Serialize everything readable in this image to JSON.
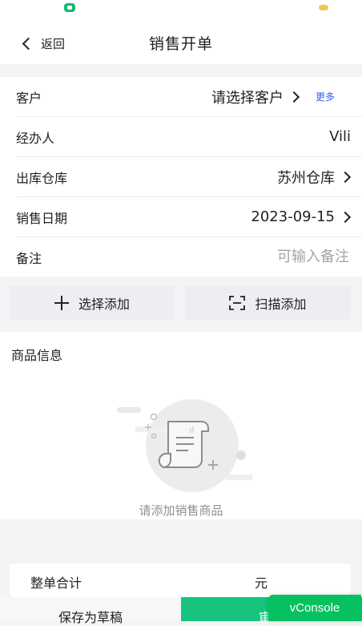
{
  "nav": {
    "back_label": "返回",
    "title": "销售开单"
  },
  "form": {
    "customer": {
      "label": "客户",
      "value": "请选择客户",
      "more": "更多"
    },
    "handler": {
      "label": "经办人",
      "value": "Vili"
    },
    "warehouse": {
      "label": "出库仓库",
      "value": "苏州仓库"
    },
    "date": {
      "label": "销售日期",
      "value": "2023-09-15"
    },
    "note": {
      "label": "备注",
      "placeholder": "可输入备注"
    }
  },
  "actions": {
    "select_add": "选择添加",
    "scan_add": "扫描添加"
  },
  "goods": {
    "title": "商品信息",
    "empty_text": "请添加销售商品"
  },
  "summary": {
    "label": "整单合计",
    "unit": "元"
  },
  "bottom": {
    "save_draft": "保存为草稿",
    "review": "审核"
  },
  "vconsole": "vConsole",
  "colors": {
    "accent": "#16c47d",
    "link": "#2f64e0",
    "background": "#f3f4f6"
  }
}
